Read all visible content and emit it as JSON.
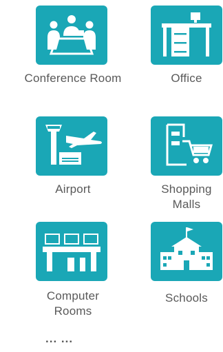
{
  "theme": {
    "tile_color": "#1aa7b6",
    "icon_color": "#ffffff",
    "label_color": "#595959"
  },
  "scenarios": [
    {
      "label": "Conference Room",
      "icon": "conference-room-icon"
    },
    {
      "label": "Office",
      "icon": "office-desk-icon"
    },
    {
      "label": "Airport",
      "icon": "airport-icon"
    },
    {
      "label": "Shopping\nMalls",
      "icon": "shopping-mall-icon"
    },
    {
      "label": "Computer\nRooms",
      "icon": "computer-room-icon"
    },
    {
      "label": "Schools",
      "icon": "school-icon"
    }
  ],
  "more_label": "... ..."
}
